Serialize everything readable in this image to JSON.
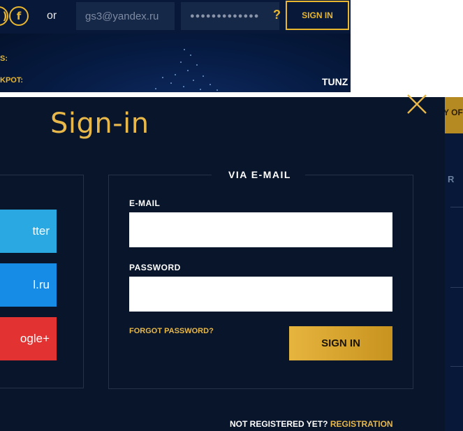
{
  "topbar": {
    "social_partial_glyph": ")",
    "facebook_glyph": "f",
    "or_text": "or",
    "email_value": "gs3@yandex.ru",
    "password_mask": "●●●●●●●●●●●●●",
    "help_glyph": "?",
    "signin_label": "SIGN IN"
  },
  "banner": {
    "label_1": "S:",
    "label_2": "KPOT:",
    "right_text": "TUNZ"
  },
  "right_strip": {
    "gold_text": "Y OF",
    "letter": "R"
  },
  "modal": {
    "title": "Sign-in",
    "social_buttons": [
      {
        "label": "tter"
      },
      {
        "label": "l.ru"
      },
      {
        "label": "ogle+"
      }
    ],
    "via_email_label": "VIA E-MAIL",
    "email_label": "E-MAIL",
    "email_value": "",
    "password_label": "PASSWORD",
    "password_value": "",
    "forgot_password": "FORGOT PASSWORD?",
    "signin_button": "SIGN IN",
    "not_registered": "NOT REGISTERED YET?",
    "registration_link": "REGISTRATION"
  },
  "colors": {
    "accent_gold": "#e8b84a",
    "modal_bg": "#08152b",
    "twitter_blue": "#29a8e1",
    "mailru_blue": "#168ce6",
    "google_red": "#e23332"
  }
}
